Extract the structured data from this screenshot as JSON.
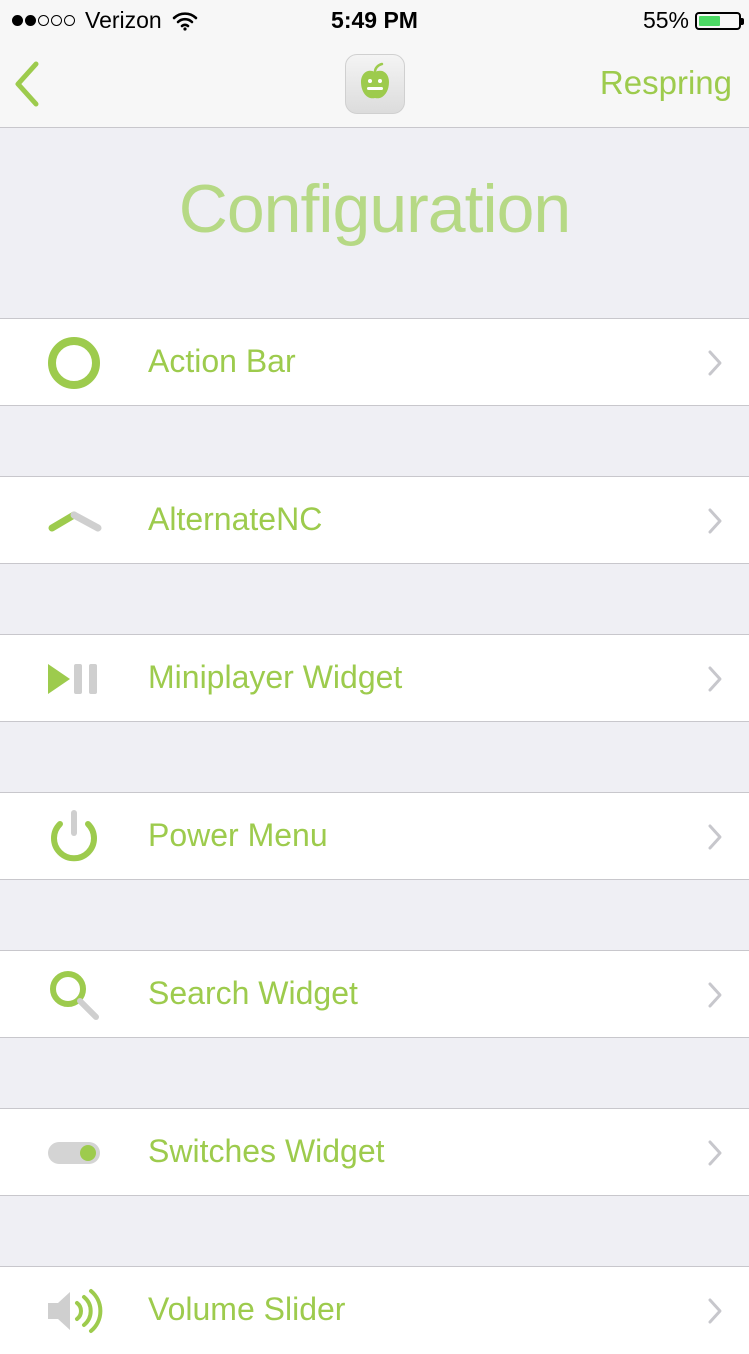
{
  "status": {
    "carrier": "Verizon",
    "time": "5:49 PM",
    "battery_pct": "55%",
    "battery_level": 0.55
  },
  "nav": {
    "right_button": "Respring"
  },
  "header": {
    "title": "Configuration"
  },
  "colors": {
    "accent": "#9dcb4d",
    "title": "#b6d985",
    "grey_icon": "#c8c8c8",
    "background": "#efeff4"
  },
  "items": [
    {
      "label": "Action Bar",
      "icon": "ring-icon"
    },
    {
      "label": "AlternateNC",
      "icon": "notch-toggle-icon"
    },
    {
      "label": "Miniplayer Widget",
      "icon": "play-pause-icon"
    },
    {
      "label": "Power Menu",
      "icon": "power-icon"
    },
    {
      "label": "Search Widget",
      "icon": "search-icon"
    },
    {
      "label": "Switches Widget",
      "icon": "switch-icon"
    },
    {
      "label": "Volume Slider",
      "icon": "speaker-icon"
    }
  ]
}
